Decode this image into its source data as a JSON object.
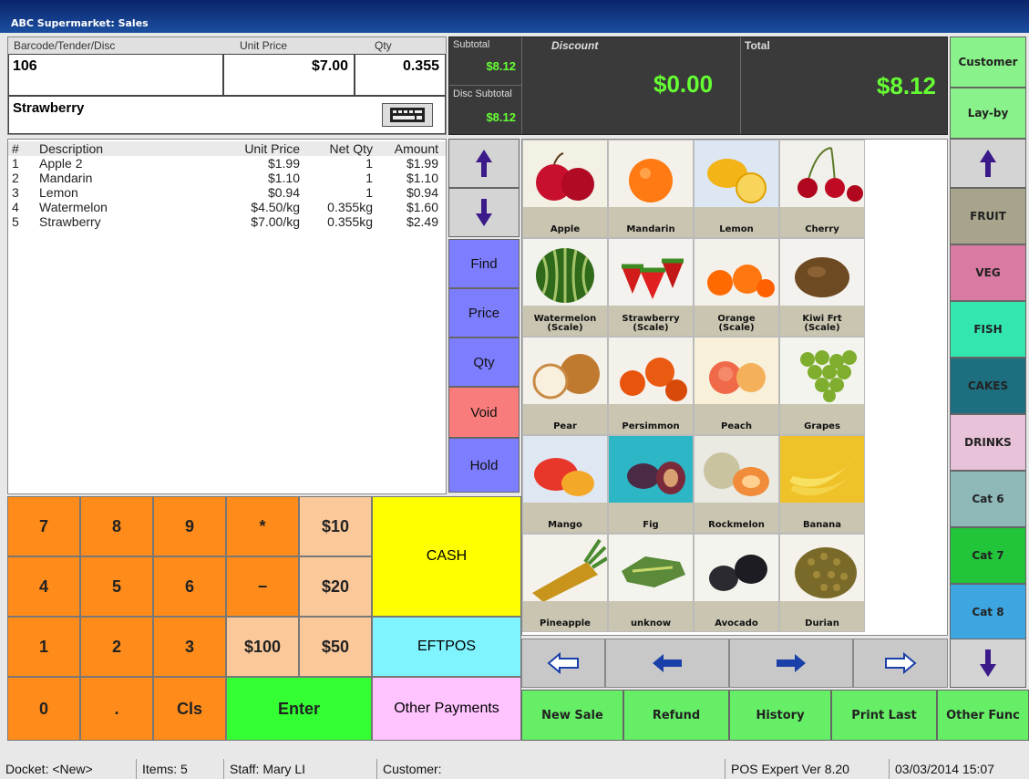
{
  "window": {
    "title": "ABC Supermarket: Sales"
  },
  "entry": {
    "barcode_label": "Barcode/Tender/Disc",
    "unit_price_label": "Unit Price",
    "qty_label": "Qty",
    "barcode_value": "106",
    "unit_price_value": "$7.00",
    "qty_value": "0.355",
    "description": "Strawberry",
    "keyboard_icon": "keyboard-icon"
  },
  "summary": {
    "subtotal_label": "Subtotal",
    "subtotal_value": "$8.12",
    "disc_subtotal_label": "Disc Subtotal",
    "disc_subtotal_value": "$8.12",
    "discount_label": "Discount",
    "discount_value": "$0.00",
    "total_label": "Total",
    "total_value": "$8.12",
    "value_color": "#66ff33"
  },
  "receipt": {
    "headers": {
      "num": "#",
      "desc": "Description",
      "unit_price": "Unit Price",
      "net_qty": "Net Qty",
      "amount": "Amount"
    },
    "rows": [
      {
        "num": "1",
        "desc": "Apple 2",
        "unit_price": "$1.99",
        "net_qty": "1",
        "amount": "$1.99"
      },
      {
        "num": "2",
        "desc": "Mandarin",
        "unit_price": "$1.10",
        "net_qty": "1",
        "amount": "$1.10"
      },
      {
        "num": "3",
        "desc": "Lemon",
        "unit_price": "$0.94",
        "net_qty": "1",
        "amount": "$0.94"
      },
      {
        "num": "4",
        "desc": "Watermelon",
        "unit_price": "$4.50/kg",
        "net_qty": "0.355kg",
        "amount": "$1.60"
      },
      {
        "num": "5",
        "desc": "Strawberry",
        "unit_price": "$7.00/kg",
        "net_qty": "0.355kg",
        "amount": "$2.49"
      }
    ]
  },
  "actions": {
    "find": "Find",
    "price": "Price",
    "qty": "Qty",
    "void": "Void",
    "hold": "Hold",
    "up_icon": "arrow-up-icon",
    "down_icon": "arrow-down-icon"
  },
  "products": [
    {
      "label": "Apple",
      "icon": "apple"
    },
    {
      "label": "Mandarin",
      "icon": "mandarin"
    },
    {
      "label": "Lemon",
      "icon": "lemon"
    },
    {
      "label": "Cherry",
      "icon": "cherry"
    },
    {
      "label": "Watermelon\n(Scale)",
      "icon": "watermelon"
    },
    {
      "label": "Strawberry\n(Scale)",
      "icon": "strawberry"
    },
    {
      "label": "Orange\n(Scale)",
      "icon": "orange"
    },
    {
      "label": "Kiwi Frt\n(Scale)",
      "icon": "kiwi"
    },
    {
      "label": "Pear",
      "icon": "pear"
    },
    {
      "label": "Persimmon",
      "icon": "persimmon"
    },
    {
      "label": "Peach",
      "icon": "peach"
    },
    {
      "label": "Grapes",
      "icon": "grapes"
    },
    {
      "label": "Mango",
      "icon": "mango"
    },
    {
      "label": "Fig",
      "icon": "fig"
    },
    {
      "label": "Rockmelon",
      "icon": "rockmelon"
    },
    {
      "label": "Banana",
      "icon": "banana"
    },
    {
      "label": "Pineapple",
      "icon": "pineapple"
    },
    {
      "label": "unknow",
      "icon": "starfruit"
    },
    {
      "label": "Avocado",
      "icon": "avocado"
    },
    {
      "label": "Durian",
      "icon": "durian"
    }
  ],
  "keypad": {
    "k7": "7",
    "k8": "8",
    "k9": "9",
    "kmul": "*",
    "k10": "$10",
    "k4": "4",
    "k5": "5",
    "k6": "6",
    "kminus": "−",
    "k20": "$20",
    "k1": "1",
    "k2": "2",
    "k3": "3",
    "k100": "$100",
    "k50": "$50",
    "k0": "0",
    "kdot": ".",
    "kcls": "Cls",
    "enter": "Enter"
  },
  "payments": {
    "cash": "CASH",
    "eftpos": "EFTPOS",
    "other": "Other Payments"
  },
  "nav": {
    "first_icon": "first-page-arrow-icon",
    "prev_icon": "prev-page-arrow-icon",
    "next_icon": "next-page-arrow-icon",
    "last_icon": "last-page-arrow-icon"
  },
  "functions": {
    "new_sale": "New Sale",
    "refund": "Refund",
    "history": "History",
    "print_last": "Print Last",
    "other_func": "Other Func"
  },
  "categories": {
    "customer": "Customer",
    "layby": "Lay-by",
    "items": [
      "FRUIT",
      "VEG",
      "FISH",
      "CAKES",
      "DRINKS",
      "Cat 6",
      "Cat 7",
      "Cat 8"
    ],
    "colors": [
      "#a8a48c",
      "#d97aa3",
      "#33e6b0",
      "#1d6f80",
      "#e8c2d8",
      "#8fb9b9",
      "#22c43a",
      "#3da6e0"
    ]
  },
  "status": {
    "docket": "Docket: <New>",
    "items": "Items: 5",
    "staff": "Staff: Mary LI",
    "customer": "Customer:",
    "version": "POS Expert Ver 8.20",
    "datetime": "03/03/2014 15:07"
  }
}
